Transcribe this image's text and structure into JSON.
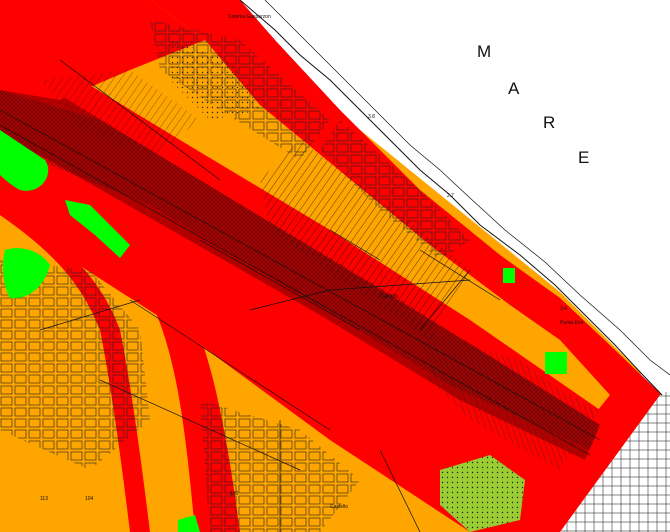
{
  "map": {
    "sea_letters": [
      "M",
      "A",
      "R",
      "E"
    ],
    "place_labels": {
      "north": "Colonia Gasparzon",
      "east": "Punta Ena",
      "center": "Centro",
      "south": "Castello"
    },
    "spot_heights": [
      "3.8",
      "2.7",
      "3.4",
      "104",
      "113",
      "130"
    ],
    "zone_colors": {
      "outer_band": "#ff0000",
      "inner_band": "#b20000",
      "urban_zone": "#ffa500",
      "green_area": "#00ff00",
      "olive_area": "#9acd32",
      "sea": "#ffffff",
      "lines": "#111111"
    }
  }
}
